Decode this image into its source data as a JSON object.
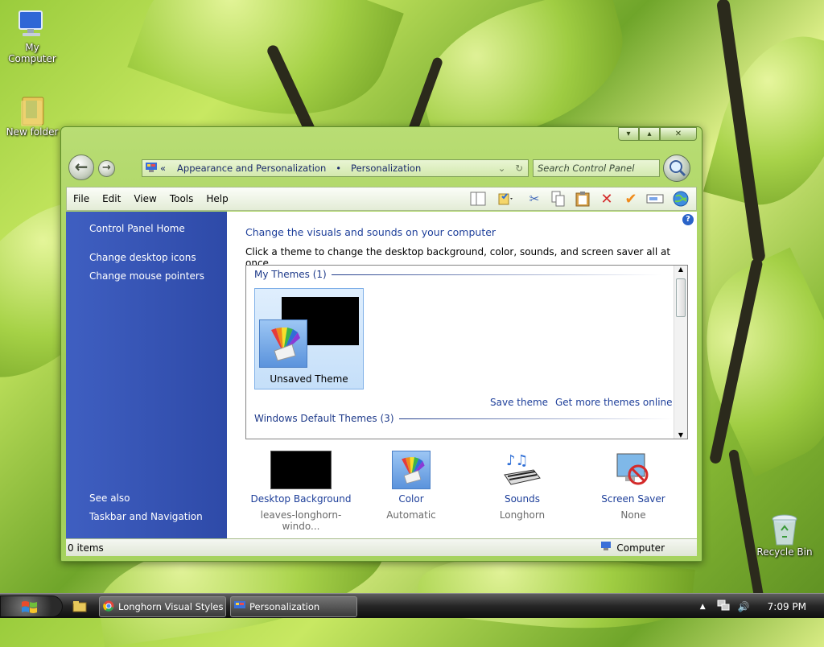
{
  "desktop": {
    "icons": [
      {
        "label": "My Computer",
        "icon": "computer-icon"
      },
      {
        "label": "New folder",
        "icon": "folder-icon"
      },
      {
        "label": "Recycle Bin",
        "icon": "recycle-bin-icon"
      }
    ]
  },
  "window": {
    "caption_buttons": {
      "minimize": "▾",
      "maximize": "▴",
      "close": "✕"
    },
    "address": {
      "overflow": "«",
      "crumbs": [
        "Appearance and Personalization",
        "Personalization"
      ],
      "separator": "•"
    },
    "search": {
      "placeholder": "Search Control Panel"
    },
    "menu": [
      "File",
      "Edit",
      "View",
      "Tools",
      "Help"
    ],
    "sidebar": {
      "home": "Control Panel Home",
      "links": [
        "Change desktop icons",
        "Change mouse pointers"
      ],
      "see_also_heading": "See also",
      "see_also": [
        "Taskbar and Navigation"
      ]
    },
    "main": {
      "title": "Change the visuals and sounds on your computer",
      "description": "Click a theme to change the desktop background, color, sounds, and screen saver all at once.",
      "help": "?",
      "my_themes_header": "My Themes (1)",
      "theme_item": "Unsaved Theme",
      "save_theme": "Save theme",
      "more_themes": "Get more themes online",
      "default_themes_header": "Windows Default Themes (3)"
    },
    "settings": [
      {
        "title": "Desktop Background",
        "value": "leaves-longhorn-windo..."
      },
      {
        "title": "Color",
        "value": "Automatic"
      },
      {
        "title": "Sounds",
        "value": "Longhorn"
      },
      {
        "title": "Screen Saver",
        "value": "None"
      }
    ],
    "status": {
      "items": "0 items",
      "zone": "Computer"
    }
  },
  "taskbar": {
    "tasks": [
      "Longhorn Visual Styles ...",
      "Personalization"
    ],
    "tray": {
      "up_arrow": "▲",
      "time": "7:09 PM"
    }
  },
  "colors": {
    "sidebar": "#3456b8",
    "link": "#1e3f9a",
    "window_frame": "#9dcb52"
  }
}
